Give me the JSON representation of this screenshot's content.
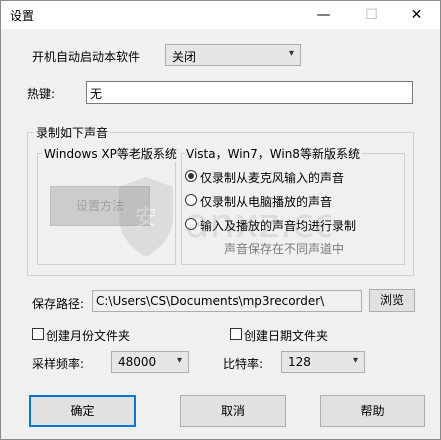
{
  "window": {
    "title": "设置",
    "minimize": "—",
    "maximize": "☐",
    "close": "✕"
  },
  "general": {
    "autostart_label": "开机自动启动本软件",
    "autostart_value": "关闭",
    "hotkey_label": "热键:",
    "hotkey_value": "无"
  },
  "record_group": {
    "title": "录制如下声音",
    "legacy_title": "Windows XP等老版系统",
    "legacy_button": "设置方法",
    "new_title": "Vista，Win7，Win8等新版系统",
    "options": [
      {
        "label": "仅录制从麦克风输入的声音",
        "selected": true
      },
      {
        "label": "仅录制从电脑播放的声音",
        "selected": false
      },
      {
        "label": "输入及播放的声音均进行录制",
        "selected": false
      }
    ],
    "note": "声音保存在不同声道中"
  },
  "save": {
    "label": "保存路径:",
    "path": "C:\\Users\\CS\\Documents\\mp3recorder\\",
    "browse_button": "浏览"
  },
  "folders": {
    "month_folder": "创建月份文件夹",
    "date_folder": "创建日期文件夹"
  },
  "audio": {
    "sample_rate_label": "采样频率:",
    "sample_rate_value": "48000",
    "bitrate_label": "比特率:",
    "bitrate_value": "128"
  },
  "footer": {
    "ok": "确定",
    "cancel": "取消",
    "help": "帮助"
  },
  "watermark": {
    "text": "anxz.com"
  }
}
